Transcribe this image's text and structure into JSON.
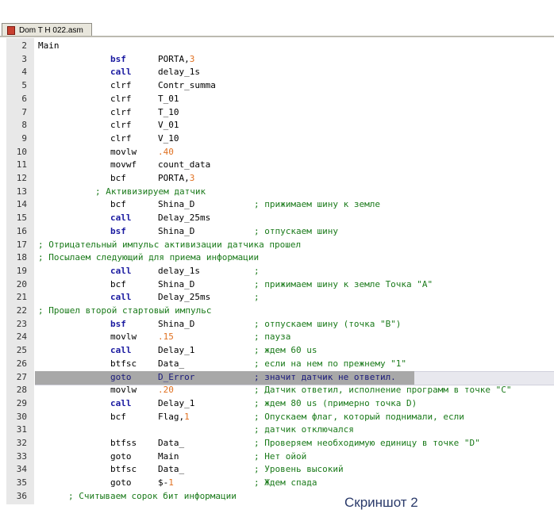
{
  "tab": {
    "title": "Dom T H 022.asm"
  },
  "lines": [
    {
      "n": "2",
      "label": "Main"
    },
    {
      "n": "3",
      "ins": "bsf",
      "bold": true,
      "arg": "PORTA,",
      "num": "3"
    },
    {
      "n": "4",
      "ins": "call",
      "bold": true,
      "arg": "delay_1s"
    },
    {
      "n": "5",
      "ins": "clrf",
      "arg": "Contr_summa"
    },
    {
      "n": "6",
      "ins": "clrf",
      "arg": "T_01"
    },
    {
      "n": "7",
      "ins": "clrf",
      "arg": "T_10"
    },
    {
      "n": "8",
      "ins": "clrf",
      "arg": "V_01"
    },
    {
      "n": "9",
      "ins": "clrf",
      "arg": "V_10"
    },
    {
      "n": "10",
      "ins": "movlw",
      "num": ".40"
    },
    {
      "n": "11",
      "ins": "movwf",
      "arg": "count_data"
    },
    {
      "n": "12",
      "ins": "bcf",
      "arg": "PORTA,",
      "num": "3"
    },
    {
      "n": "13",
      "free": "; Активизируем датчик",
      "indent": 120
    },
    {
      "n": "14",
      "ins": "bcf",
      "arg": "Shina_D",
      "cmt": "; прижимаем шину к земле"
    },
    {
      "n": "15",
      "ins": "call",
      "bold": true,
      "arg": "Delay_25ms"
    },
    {
      "n": "16",
      "ins": "bsf",
      "bold": true,
      "arg": "Shina_D",
      "cmt": "; отпускаем шину"
    },
    {
      "n": "17",
      "free": "; Отрицательный импульс активизации датчика прошел",
      "indent": 48
    },
    {
      "n": "18",
      "free": "; Посылаем следующий для приема информации",
      "indent": 48
    },
    {
      "n": "19",
      "ins": "call",
      "bold": true,
      "arg": "delay_1s",
      "cmt": ";"
    },
    {
      "n": "20",
      "ins": "bcf",
      "arg": "Shina_D",
      "cmt": "; прижимаем шину к земле Точка \"A\""
    },
    {
      "n": "21",
      "ins": "call",
      "bold": true,
      "arg": "Delay_25ms",
      "cmt": ";"
    },
    {
      "n": "22",
      "free": "; Прошел второй стартовый импульс",
      "indent": 48
    },
    {
      "n": "23",
      "ins": "bsf",
      "bold": true,
      "arg": "Shina_D",
      "cmt": "; отпускаем шину (точка \"B\")"
    },
    {
      "n": "24",
      "ins": "movlw",
      "num": ".15",
      "cmt": "; пауза"
    },
    {
      "n": "25",
      "ins": "call",
      "bold": true,
      "arg": "Delay_1",
      "cmt": "; ждем 60 us"
    },
    {
      "n": "26",
      "ins": "btfsc",
      "arg": "Data_",
      "cmt": "; если на нем по прежнему \"1\""
    },
    {
      "n": "27",
      "ins": "goto",
      "arg": "D_Error",
      "cmt": "; значит датчик не ответил.",
      "highlight": true
    },
    {
      "n": "28",
      "ins": "movlw",
      "num": ".20",
      "cmt": "; Датчик ответил, исполнение программ в точке \"C\""
    },
    {
      "n": "29",
      "ins": "call",
      "bold": true,
      "arg": "Delay_1",
      "cmt": "; ждем 80 us (примерно точка D)"
    },
    {
      "n": "30",
      "ins": "bcf",
      "arg": "Flag,",
      "num": "1",
      "cmt": "; Опускаем флаг, который поднимали, если"
    },
    {
      "n": "31",
      "cmt": "; датчик отключался"
    },
    {
      "n": "32",
      "ins": "btfss",
      "arg": "Data_",
      "cmt": "; Проверяем необходимую единицу в точке \"D\""
    },
    {
      "n": "33",
      "ins": "goto",
      "arg": "Main",
      "cmt": "; Нет ойой"
    },
    {
      "n": "34",
      "ins": "btfsc",
      "arg": "Data_",
      "cmt": "; Уровень высокий"
    },
    {
      "n": "35",
      "ins": "goto",
      "arg": "$-",
      "num": "1",
      "cmt": "; Ждем спада"
    },
    {
      "n": "36",
      "free": "; Считываем сорок бит информации",
      "indent": 86
    }
  ],
  "caption": "Скриншот 2",
  "colors": {
    "keyword": "#1a1aa0",
    "comment": "#1a7a1a",
    "number": "#e07020",
    "gutter": "#e8e8e8",
    "selection": "#a8a8a8"
  }
}
